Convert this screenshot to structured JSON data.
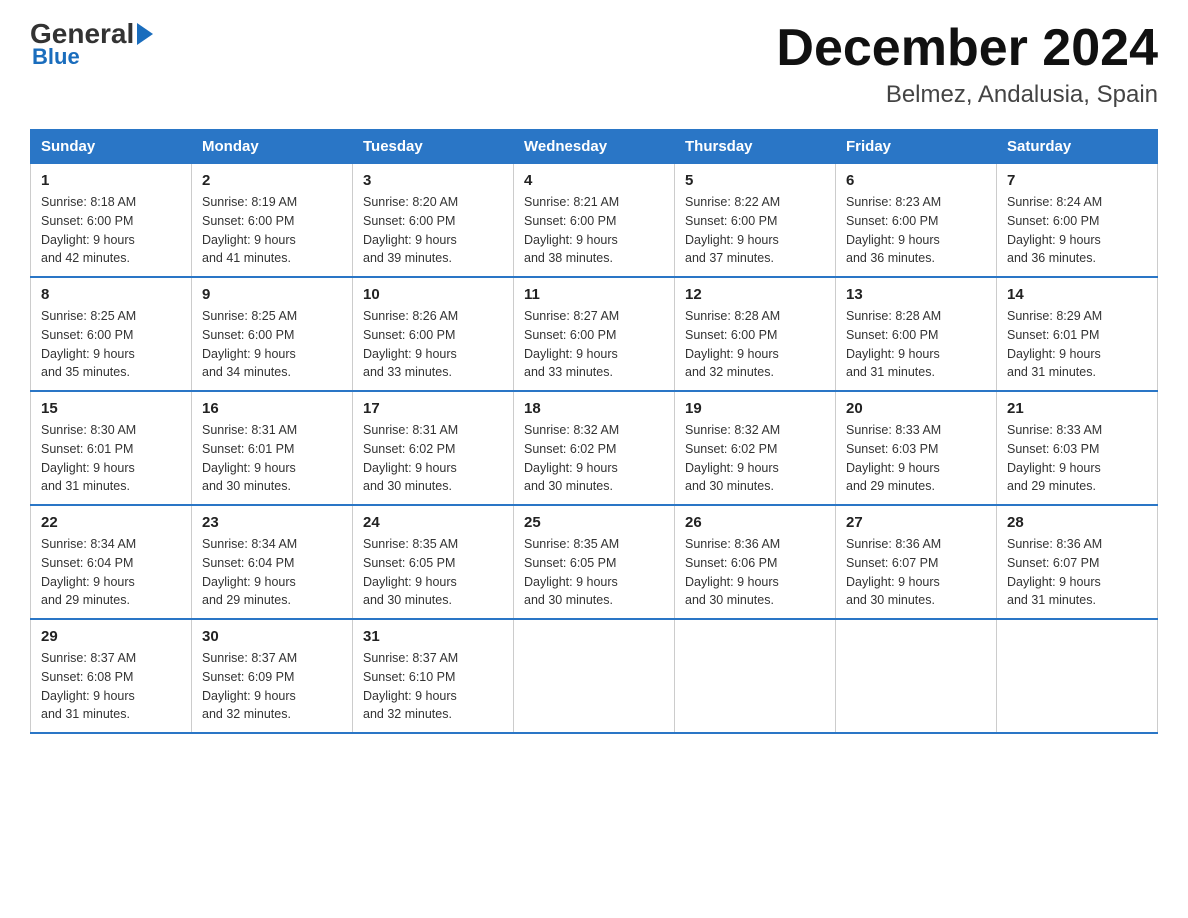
{
  "header": {
    "logo": {
      "general": "General",
      "arrow": "▶",
      "blue": "Blue"
    },
    "title": "December 2024",
    "location": "Belmez, Andalusia, Spain"
  },
  "days_of_week": [
    "Sunday",
    "Monday",
    "Tuesday",
    "Wednesday",
    "Thursday",
    "Friday",
    "Saturday"
  ],
  "weeks": [
    [
      {
        "day": "1",
        "sunrise": "8:18 AM",
        "sunset": "6:00 PM",
        "daylight": "9 hours and 42 minutes."
      },
      {
        "day": "2",
        "sunrise": "8:19 AM",
        "sunset": "6:00 PM",
        "daylight": "9 hours and 41 minutes."
      },
      {
        "day": "3",
        "sunrise": "8:20 AM",
        "sunset": "6:00 PM",
        "daylight": "9 hours and 39 minutes."
      },
      {
        "day": "4",
        "sunrise": "8:21 AM",
        "sunset": "6:00 PM",
        "daylight": "9 hours and 38 minutes."
      },
      {
        "day": "5",
        "sunrise": "8:22 AM",
        "sunset": "6:00 PM",
        "daylight": "9 hours and 37 minutes."
      },
      {
        "day": "6",
        "sunrise": "8:23 AM",
        "sunset": "6:00 PM",
        "daylight": "9 hours and 36 minutes."
      },
      {
        "day": "7",
        "sunrise": "8:24 AM",
        "sunset": "6:00 PM",
        "daylight": "9 hours and 36 minutes."
      }
    ],
    [
      {
        "day": "8",
        "sunrise": "8:25 AM",
        "sunset": "6:00 PM",
        "daylight": "9 hours and 35 minutes."
      },
      {
        "day": "9",
        "sunrise": "8:25 AM",
        "sunset": "6:00 PM",
        "daylight": "9 hours and 34 minutes."
      },
      {
        "day": "10",
        "sunrise": "8:26 AM",
        "sunset": "6:00 PM",
        "daylight": "9 hours and 33 minutes."
      },
      {
        "day": "11",
        "sunrise": "8:27 AM",
        "sunset": "6:00 PM",
        "daylight": "9 hours and 33 minutes."
      },
      {
        "day": "12",
        "sunrise": "8:28 AM",
        "sunset": "6:00 PM",
        "daylight": "9 hours and 32 minutes."
      },
      {
        "day": "13",
        "sunrise": "8:28 AM",
        "sunset": "6:00 PM",
        "daylight": "9 hours and 31 minutes."
      },
      {
        "day": "14",
        "sunrise": "8:29 AM",
        "sunset": "6:01 PM",
        "daylight": "9 hours and 31 minutes."
      }
    ],
    [
      {
        "day": "15",
        "sunrise": "8:30 AM",
        "sunset": "6:01 PM",
        "daylight": "9 hours and 31 minutes."
      },
      {
        "day": "16",
        "sunrise": "8:31 AM",
        "sunset": "6:01 PM",
        "daylight": "9 hours and 30 minutes."
      },
      {
        "day": "17",
        "sunrise": "8:31 AM",
        "sunset": "6:02 PM",
        "daylight": "9 hours and 30 minutes."
      },
      {
        "day": "18",
        "sunrise": "8:32 AM",
        "sunset": "6:02 PM",
        "daylight": "9 hours and 30 minutes."
      },
      {
        "day": "19",
        "sunrise": "8:32 AM",
        "sunset": "6:02 PM",
        "daylight": "9 hours and 30 minutes."
      },
      {
        "day": "20",
        "sunrise": "8:33 AM",
        "sunset": "6:03 PM",
        "daylight": "9 hours and 29 minutes."
      },
      {
        "day": "21",
        "sunrise": "8:33 AM",
        "sunset": "6:03 PM",
        "daylight": "9 hours and 29 minutes."
      }
    ],
    [
      {
        "day": "22",
        "sunrise": "8:34 AM",
        "sunset": "6:04 PM",
        "daylight": "9 hours and 29 minutes."
      },
      {
        "day": "23",
        "sunrise": "8:34 AM",
        "sunset": "6:04 PM",
        "daylight": "9 hours and 29 minutes."
      },
      {
        "day": "24",
        "sunrise": "8:35 AM",
        "sunset": "6:05 PM",
        "daylight": "9 hours and 30 minutes."
      },
      {
        "day": "25",
        "sunrise": "8:35 AM",
        "sunset": "6:05 PM",
        "daylight": "9 hours and 30 minutes."
      },
      {
        "day": "26",
        "sunrise": "8:36 AM",
        "sunset": "6:06 PM",
        "daylight": "9 hours and 30 minutes."
      },
      {
        "day": "27",
        "sunrise": "8:36 AM",
        "sunset": "6:07 PM",
        "daylight": "9 hours and 30 minutes."
      },
      {
        "day": "28",
        "sunrise": "8:36 AM",
        "sunset": "6:07 PM",
        "daylight": "9 hours and 31 minutes."
      }
    ],
    [
      {
        "day": "29",
        "sunrise": "8:37 AM",
        "sunset": "6:08 PM",
        "daylight": "9 hours and 31 minutes."
      },
      {
        "day": "30",
        "sunrise": "8:37 AM",
        "sunset": "6:09 PM",
        "daylight": "9 hours and 32 minutes."
      },
      {
        "day": "31",
        "sunrise": "8:37 AM",
        "sunset": "6:10 PM",
        "daylight": "9 hours and 32 minutes."
      },
      null,
      null,
      null,
      null
    ]
  ],
  "labels": {
    "sunrise": "Sunrise:",
    "sunset": "Sunset:",
    "daylight": "Daylight:"
  }
}
